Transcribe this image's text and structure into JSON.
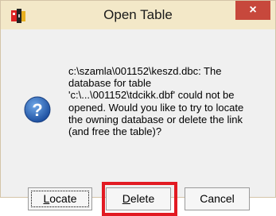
{
  "window": {
    "title": "Open Table",
    "close_glyph": "×",
    "app_icon": "foxpro-app-icon"
  },
  "message": {
    "icon": "question-icon",
    "text": "c:\\szamla\\001152\\keszd.dbc: The\ndatabase for table\n'c:\\...\\001152\\tdcikk.dbf' could not be\nopened. Would you like to try to locate\nthe owning database or delete the link\n(and free the table)?"
  },
  "buttons": {
    "locate": {
      "accel": "L",
      "rest": "ocate"
    },
    "delete": {
      "accel": "D",
      "rest": "elete"
    },
    "cancel": "Cancel"
  },
  "annotation": {
    "highlight_color": "#e21a22"
  }
}
